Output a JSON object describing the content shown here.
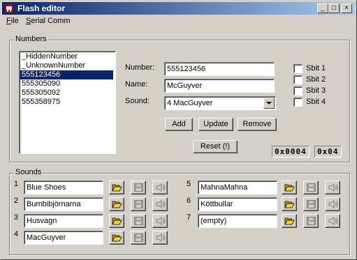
{
  "window": {
    "title": "Flash editor",
    "titlebar_color": "#0a246a",
    "minimize": "_",
    "maximize": "□",
    "close": "×"
  },
  "menu": [
    {
      "first": "F",
      "rest": "ile"
    },
    {
      "first": "S",
      "rest": "erial Comm"
    }
  ],
  "numbers": {
    "group_label": "Numbers",
    "list": [
      "_HiddenNumber",
      "_UnknownNumber",
      "555123456",
      "555305090",
      "555305092",
      "555358975"
    ],
    "selected_index": 2,
    "number_label": "Number:",
    "number_value": "555123456",
    "name_label": "Name:",
    "name_value": "McGuyver",
    "sound_label": "Sound:",
    "sound_value": "4 MacGuyver",
    "add": "Add",
    "update": "Update",
    "remove": "Remove",
    "reset": "Reset (!)",
    "sbits": [
      "Sbit 1",
      "Sbit 2",
      "Sbit 3",
      "Sbit 4"
    ],
    "hex_long": "0x0004",
    "hex_short": "0x04"
  },
  "sounds": {
    "group_label": "Sounds",
    "slots": [
      {
        "num": "1",
        "name": "Blue Shoes"
      },
      {
        "num": "2",
        "name": "Bumbibjörnarna"
      },
      {
        "num": "3",
        "name": "Husvagn"
      },
      {
        "num": "4",
        "name": "MacGuyver"
      },
      {
        "num": "5",
        "name": "MahnaMahna"
      },
      {
        "num": "6",
        "name": "Köttbullar"
      },
      {
        "num": "7",
        "name": "(empty)"
      }
    ],
    "icons": [
      "open-folder-icon",
      "save-disk-icon",
      "speaker-icon"
    ]
  }
}
